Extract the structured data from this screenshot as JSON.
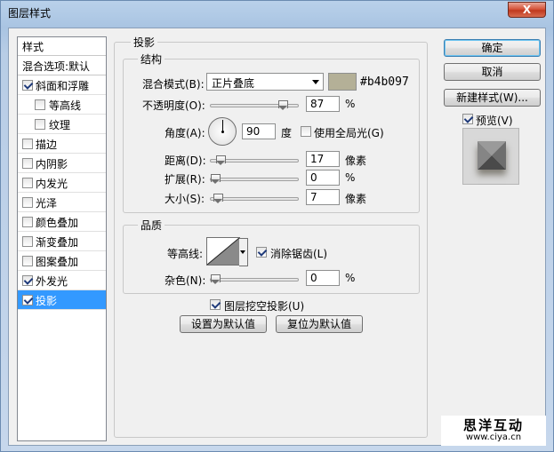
{
  "window": {
    "title": "图层样式",
    "close_label": "X"
  },
  "styles": {
    "header": "样式",
    "blend_options": "混合选项:默认",
    "items": [
      {
        "label": "斜面和浮雕",
        "checked": true,
        "sub": false,
        "selected": false
      },
      {
        "label": "等高线",
        "checked": false,
        "sub": true,
        "selected": false
      },
      {
        "label": "纹理",
        "checked": false,
        "sub": true,
        "selected": false
      },
      {
        "label": "描边",
        "checked": false,
        "sub": false,
        "selected": false
      },
      {
        "label": "内阴影",
        "checked": false,
        "sub": false,
        "selected": false
      },
      {
        "label": "内发光",
        "checked": false,
        "sub": false,
        "selected": false
      },
      {
        "label": "光泽",
        "checked": false,
        "sub": false,
        "selected": false
      },
      {
        "label": "颜色叠加",
        "checked": false,
        "sub": false,
        "selected": false
      },
      {
        "label": "渐变叠加",
        "checked": false,
        "sub": false,
        "selected": false
      },
      {
        "label": "图案叠加",
        "checked": false,
        "sub": false,
        "selected": false
      },
      {
        "label": "外发光",
        "checked": true,
        "sub": false,
        "selected": false
      },
      {
        "label": "投影",
        "checked": true,
        "sub": false,
        "selected": true
      }
    ]
  },
  "drop_shadow": {
    "group_label": "投影",
    "structure": {
      "group_label": "结构",
      "blend_mode_label": "混合模式(B):",
      "blend_mode_value": "正片叠底",
      "color_hex": "#b4b097",
      "opacity_label": "不透明度(O):",
      "opacity_value": "87",
      "opacity_unit": "%",
      "opacity_level": 0.87,
      "angle_label": "角度(A):",
      "angle_value": "90",
      "angle_unit": "度",
      "global_light_label": "使用全局光(G)",
      "global_light_checked": false,
      "distance_label": "距离(D):",
      "distance_value": "17",
      "distance_unit": "像素",
      "distance_level": 0.07,
      "spread_label": "扩展(R):",
      "spread_value": "0",
      "spread_unit": "%",
      "spread_level": 0.0,
      "size_label": "大小(S):",
      "size_value": "7",
      "size_unit": "像素",
      "size_level": 0.03
    },
    "quality": {
      "group_label": "品质",
      "contour_label": "等高线:",
      "antialias_label": "消除锯齿(L)",
      "antialias_checked": true,
      "noise_label": "杂色(N):",
      "noise_value": "0",
      "noise_unit": "%",
      "noise_level": 0.0
    },
    "knockout_label": "图层挖空投影(U)",
    "knockout_checked": true,
    "make_default_label": "设置为默认值",
    "reset_default_label": "复位为默认值"
  },
  "buttons": {
    "ok": "确定",
    "cancel": "取消",
    "new_style": "新建样式(W)...",
    "preview_label": "预览(V)",
    "preview_checked": true
  },
  "watermark": {
    "title": "思洋互动",
    "url": "www.ciya.cn"
  }
}
